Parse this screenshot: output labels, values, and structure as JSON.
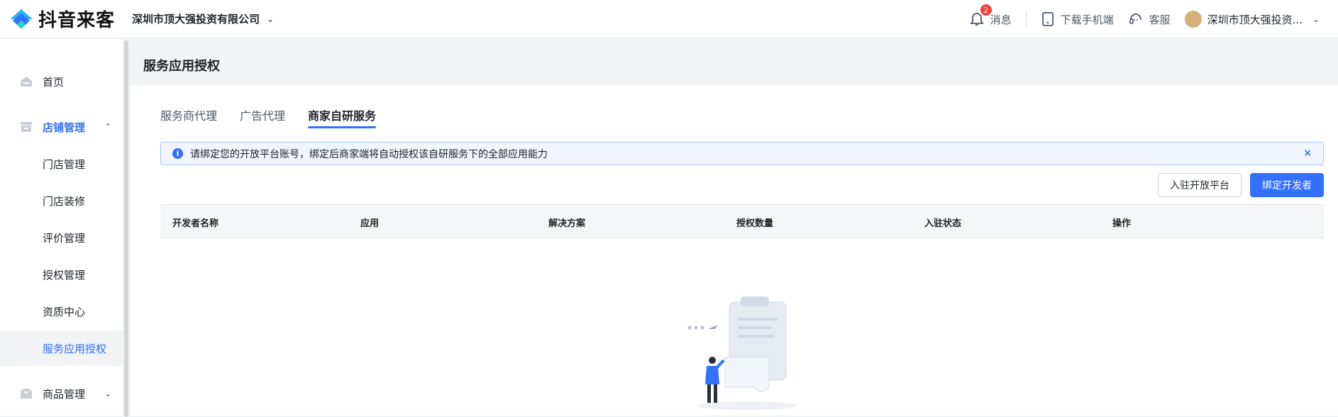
{
  "header": {
    "logo_text": "抖音来客",
    "company": "深圳市顶大强投资有限公司",
    "notifications_count": "2",
    "messages_label": "消息",
    "download_label": "下载手机端",
    "service_label": "客服",
    "user_name": "深圳市顶大强投资..."
  },
  "sidebar": {
    "items": [
      {
        "label": "首页",
        "icon": "home-icon"
      },
      {
        "label": "店铺管理",
        "icon": "store-icon",
        "expanded": true
      },
      {
        "label": "门店管理"
      },
      {
        "label": "门店装修"
      },
      {
        "label": "评价管理"
      },
      {
        "label": "授权管理"
      },
      {
        "label": "资质中心"
      },
      {
        "label": "服务应用授权",
        "active": true
      },
      {
        "label": "商品管理",
        "icon": "goods-icon",
        "expanded": false
      }
    ]
  },
  "main": {
    "page_title": "服务应用授权",
    "tabs": [
      {
        "label": "服务商代理"
      },
      {
        "label": "广告代理"
      },
      {
        "label": "商家自研服务",
        "active": true
      }
    ],
    "alert_text": "请绑定您的开放平台账号，绑定后商家端将自动授权该自研服务下的全部应用能力",
    "alert_close": "×",
    "join_button": "入驻开放平台",
    "bind_button": "绑定开发者",
    "table_columns": [
      "开发者名称",
      "应用",
      "解决方案",
      "授权数量",
      "入驻状态",
      "操作"
    ]
  },
  "colors": {
    "accent": "#3370ff",
    "badge": "#f53f3f"
  }
}
